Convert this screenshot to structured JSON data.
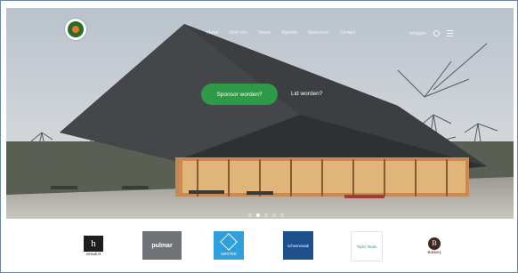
{
  "nav": {
    "items": [
      "Home",
      "Over ons",
      "Teams",
      "Agenda",
      "Sponsoren",
      "Contact"
    ],
    "login": "Inloggen"
  },
  "hero": {
    "cta_primary": "Sponsor worden?",
    "cta_secondary": "Lid worden?",
    "slide_count": 5,
    "active_slide": 1
  },
  "sponsors": [
    {
      "name": "emsak.nl"
    },
    {
      "name": "pulmar"
    },
    {
      "name": "iWRITER"
    },
    {
      "name": "schoonmaak"
    },
    {
      "name": "Taylor Made"
    },
    {
      "name": "Bakkerij"
    }
  ],
  "colors": {
    "accent": "#2e9a47",
    "frame": "#6a86a8"
  }
}
